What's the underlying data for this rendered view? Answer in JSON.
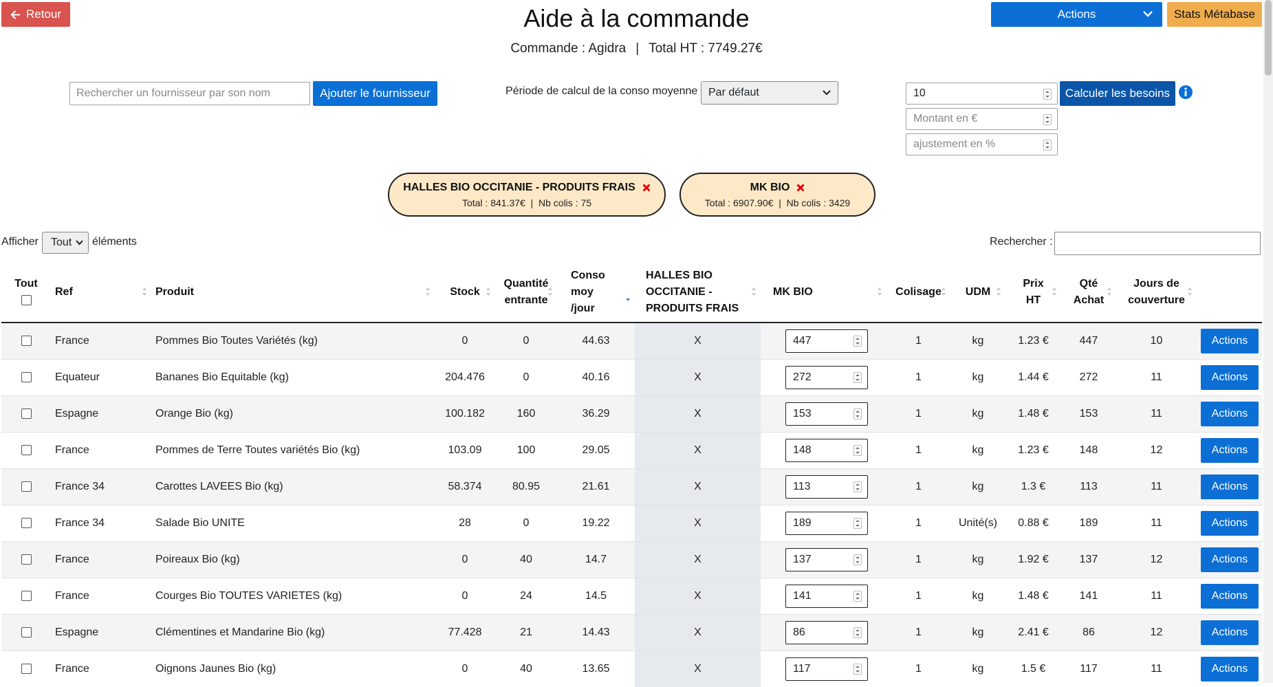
{
  "header": {
    "back_label": "Retour",
    "title": "Aide à la commande",
    "subtitle_order": "Commande : Agidra",
    "subtitle_sep": "|",
    "subtitle_total": "Total HT : 7749.27€",
    "actions_label": "Actions",
    "stats_label": "Stats Métabase"
  },
  "controls": {
    "supplier_search_placeholder": "Rechercher un fournisseur par son nom",
    "add_supplier_label": "Ajouter le fournisseur",
    "period_label": "Période de calcul de la conso moyenne",
    "period_value": "Par défaut",
    "days_value": "10",
    "amount_placeholder": "Montant en €",
    "adjust_placeholder": "ajustement en %",
    "calc_label": "Calculer les besoins"
  },
  "suppliers": [
    {
      "name": "HALLES BIO OCCITANIE - PRODUITS FRAIS",
      "info": "Total : 841.37€  |  Nb colis : 75"
    },
    {
      "name": "MK BIO",
      "info": "Total : 6907.90€  |  Nb colis : 3429"
    }
  ],
  "table_controls": {
    "show_label": "Afficher",
    "show_value": "Tout",
    "show_suffix": "éléments",
    "search_label": "Rechercher :"
  },
  "columns": {
    "all": "Tout",
    "ref": "Ref",
    "product": "Produit",
    "stock": "Stock",
    "incoming_1": "Quantité",
    "incoming_2": "entrante",
    "conso_1": "Conso",
    "conso_2": "moy",
    "conso_3": "/jour",
    "halles_1": "HALLES BIO",
    "halles_2": "OCCITANIE -",
    "halles_3": "PRODUITS FRAIS",
    "mk": "MK BIO",
    "colisage": "Colisage",
    "udm": "UDM",
    "price_1": "Prix",
    "price_2": "HT",
    "qty_1": "Qté",
    "qty_2": "Achat",
    "days_1": "Jours de",
    "days_2": "couverture"
  },
  "rows": [
    {
      "ref": "France",
      "product": "Pommes Bio Toutes Variétés (kg)",
      "stock": "0",
      "incoming": "0",
      "conso": "44.63",
      "halles": "X",
      "mk": "447",
      "colisage": "1",
      "udm": "kg",
      "price": "1.23 €",
      "qty": "447",
      "days": "10",
      "action": "Actions"
    },
    {
      "ref": "Equateur",
      "product": "Bananes Bio Equitable (kg)",
      "stock": "204.476",
      "incoming": "0",
      "conso": "40.16",
      "halles": "X",
      "mk": "272",
      "colisage": "1",
      "udm": "kg",
      "price": "1.44 €",
      "qty": "272",
      "days": "11",
      "action": "Actions"
    },
    {
      "ref": "Espagne",
      "product": "Orange Bio (kg)",
      "stock": "100.182",
      "incoming": "160",
      "conso": "36.29",
      "halles": "X",
      "mk": "153",
      "colisage": "1",
      "udm": "kg",
      "price": "1.48 €",
      "qty": "153",
      "days": "11",
      "action": "Actions"
    },
    {
      "ref": "France",
      "product": "Pommes de Terre Toutes variétés Bio (kg)",
      "stock": "103.09",
      "incoming": "100",
      "conso": "29.05",
      "halles": "X",
      "mk": "148",
      "colisage": "1",
      "udm": "kg",
      "price": "1.23 €",
      "qty": "148",
      "days": "12",
      "action": "Actions"
    },
    {
      "ref": "France 34",
      "product": "Carottes LAVEES Bio (kg)",
      "stock": "58.374",
      "incoming": "80.95",
      "conso": "21.61",
      "halles": "X",
      "mk": "113",
      "colisage": "1",
      "udm": "kg",
      "price": "1.3 €",
      "qty": "113",
      "days": "11",
      "action": "Actions"
    },
    {
      "ref": "France 34",
      "product": "Salade Bio UNITE",
      "stock": "28",
      "incoming": "0",
      "conso": "19.22",
      "halles": "X",
      "mk": "189",
      "colisage": "1",
      "udm": "Unité(s)",
      "price": "0.88 €",
      "qty": "189",
      "days": "11",
      "action": "Actions"
    },
    {
      "ref": "France",
      "product": "Poireaux Bio (kg)",
      "stock": "0",
      "incoming": "40",
      "conso": "14.7",
      "halles": "X",
      "mk": "137",
      "colisage": "1",
      "udm": "kg",
      "price": "1.92 €",
      "qty": "137",
      "days": "12",
      "action": "Actions"
    },
    {
      "ref": "France",
      "product": "Courges Bio TOUTES VARIETES (kg)",
      "stock": "0",
      "incoming": "24",
      "conso": "14.5",
      "halles": "X",
      "mk": "141",
      "colisage": "1",
      "udm": "kg",
      "price": "1.48 €",
      "qty": "141",
      "days": "11",
      "action": "Actions"
    },
    {
      "ref": "Espagne",
      "product": "Clémentines et Mandarine Bio (kg)",
      "stock": "77.428",
      "incoming": "21",
      "conso": "14.43",
      "halles": "X",
      "mk": "86",
      "colisage": "1",
      "udm": "kg",
      "price": "2.41 €",
      "qty": "86",
      "days": "12",
      "action": "Actions"
    },
    {
      "ref": "France",
      "product": "Oignons Jaunes Bio (kg)",
      "stock": "0",
      "incoming": "40",
      "conso": "13.65",
      "halles": "X",
      "mk": "117",
      "colisage": "1",
      "udm": "kg",
      "price": "1.5 €",
      "qty": "117",
      "days": "11",
      "action": "Actions"
    }
  ]
}
